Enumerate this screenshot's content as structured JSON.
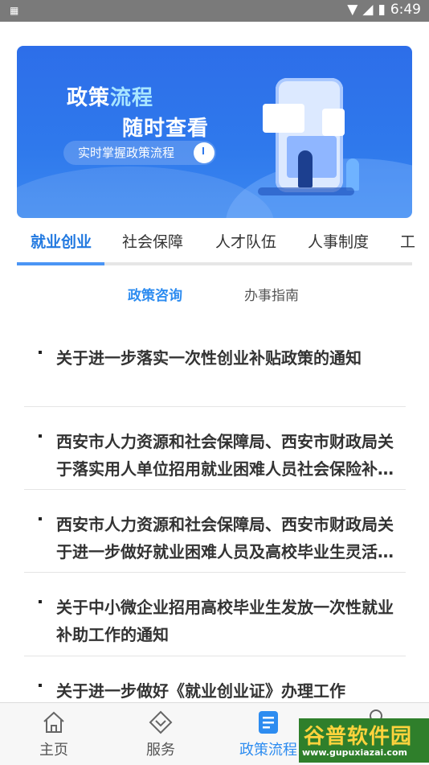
{
  "status_bar": {
    "time": "6:49",
    "left_icon": "sim-icon"
  },
  "banner": {
    "title_part1": "政策",
    "title_part2": "流程",
    "subtitle": "随时查看",
    "pill_text": "实时掌握政策流程"
  },
  "tabs": [
    {
      "label": "就业创业",
      "active": true
    },
    {
      "label": "社会保障",
      "active": false
    },
    {
      "label": "人才队伍",
      "active": false
    },
    {
      "label": "人事制度",
      "active": false
    },
    {
      "label": "工",
      "active": false
    }
  ],
  "sub_tabs": [
    {
      "label": "政策咨询",
      "active": true
    },
    {
      "label": "办事指南",
      "active": false
    }
  ],
  "list": [
    {
      "title": "关于进一步落实一次性创业补贴政策的通知"
    },
    {
      "title": "西安市人力资源和社会保障局、西安市财政局关于落实用人单位招用就业困难人员社会保险补贴政策的通知"
    },
    {
      "title": "西安市人力资源和社会保障局、西安市财政局关于进一步做好就业困难人员及高校毕业生灵活就业社会保险补贴工作的通知"
    },
    {
      "title": "关于中小微企业招用高校毕业生发放一次性就业补助工作的通知"
    },
    {
      "title": "关于进一步做好《就业创业证》办理工作"
    }
  ],
  "bottom_nav": [
    {
      "label": "主页",
      "icon": "home-icon",
      "active": false
    },
    {
      "label": "服务",
      "icon": "service-icon",
      "active": false
    },
    {
      "label": "政策流程",
      "icon": "policy-document-icon",
      "active": true
    }
  ],
  "watermark": {
    "big": "谷普软件园",
    "small": "www.gupuxiazai.com"
  },
  "colors": {
    "accent": "#2d8cf0",
    "banner": "#2f79ec",
    "tab_active": "#2279e0"
  }
}
